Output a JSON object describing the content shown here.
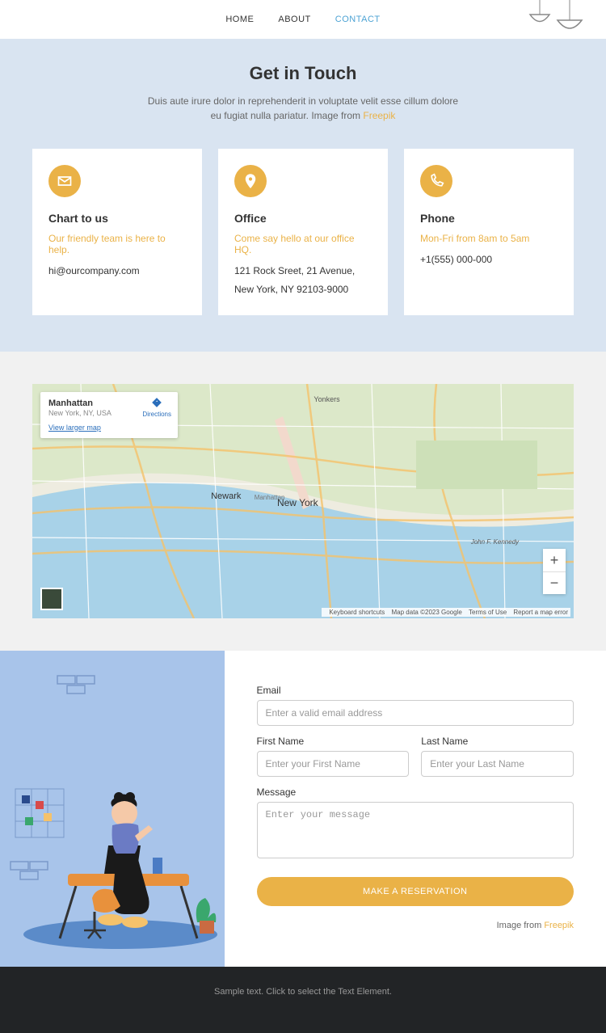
{
  "nav": {
    "home": "HOME",
    "about": "ABOUT",
    "contact": "CONTACT"
  },
  "hero": {
    "title": "Get in Touch",
    "subtitle_before": "Duis aute irure dolor in reprehenderit in voluptate velit esse cillum dolore eu fugiat nulla pariatur. Image from ",
    "subtitle_link": "Freepik"
  },
  "cards": {
    "chat": {
      "title": "Chart to us",
      "tagline": "Our friendly team is here to help.",
      "line1": "hi@ourcompany.com"
    },
    "office": {
      "title": "Office",
      "tagline": "Come say hello at our office HQ.",
      "line1": "121 Rock Sreet, 21 Avenue,",
      "line2": "New York, NY 92103-9000"
    },
    "phone": {
      "title": "Phone",
      "tagline": "Mon-Fri from 8am to 5am",
      "line1": "+1(555) 000-000"
    }
  },
  "map": {
    "infobox_title": "Manhattan",
    "infobox_subtitle": "New York, NY, USA",
    "infobox_link": "View larger map",
    "directions": "Directions",
    "label_newyork": "New York",
    "label_manhattan": "Manhattan",
    "label_newark": "Newark",
    "label_yonkers": "Yonkers",
    "label_jn": "John F. Kennedy",
    "attr_kb": "Keyboard shortcuts",
    "attr_data": "Map data ©2023 Google",
    "attr_terms": "Terms of Use",
    "attr_report": "Report a map error"
  },
  "form": {
    "email_label": "Email",
    "email_ph": "Enter a valid email address",
    "fname_label": "First Name",
    "fname_ph": "Enter your First Name",
    "lname_label": "Last Name",
    "lname_ph": "Enter your Last Name",
    "msg_label": "Message",
    "msg_ph": "Enter your message",
    "submit": "MAKE A RESERVATION",
    "credit_before": "Image from ",
    "credit_link": "Freepik"
  },
  "footer": {
    "text": "Sample text. Click to select the Text Element."
  }
}
